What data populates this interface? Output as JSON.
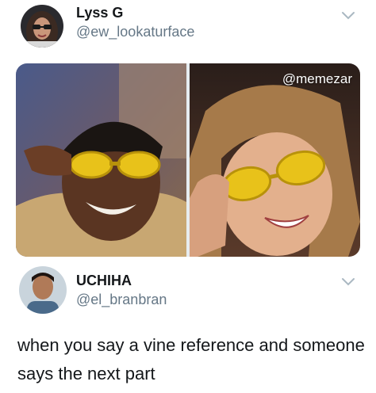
{
  "tweet1": {
    "name": "Lyss G",
    "handle": "@ew_lookaturface",
    "avatar_icon": "user-avatar-glasses",
    "menu_icon": "chevron-down-icon"
  },
  "media": {
    "watermark": "@memezar",
    "left_image": "man-yellow-sunglasses-photo",
    "right_image": "woman-yellow-sunglasses-photo"
  },
  "tweet2": {
    "name": "UCHIHA",
    "handle": "@el_branbran",
    "avatar_icon": "user-avatar-portrait",
    "menu_icon": "chevron-down-icon",
    "text": "when you say a vine reference and someone says the next part"
  },
  "colors": {
    "text_primary": "#14171a",
    "text_secondary": "#657786",
    "chevron": "#aab8c2",
    "sunglasses": "#e8c21a"
  }
}
